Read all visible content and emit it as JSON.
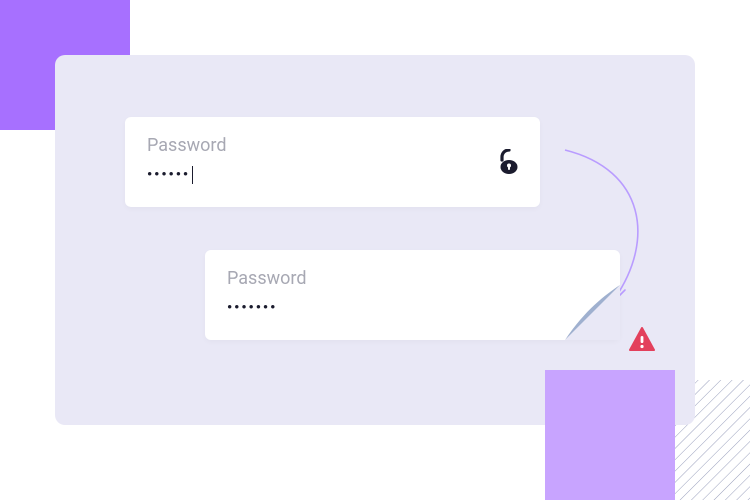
{
  "password_field_active": {
    "label": "Password",
    "masked_value": "••••••"
  },
  "password_field_error": {
    "label": "Password",
    "masked_value": "•••••••"
  },
  "icons": {
    "lock": "lock-open-icon",
    "alert": "warning-icon"
  },
  "colors": {
    "accent": "#a770ff",
    "accent_light": "#c8a4ff",
    "panel": "#e9e8f6",
    "label": "#a7a8b3",
    "text": "#1b1c2e",
    "error": "#e3405c",
    "fold": "#9fb0cf"
  }
}
